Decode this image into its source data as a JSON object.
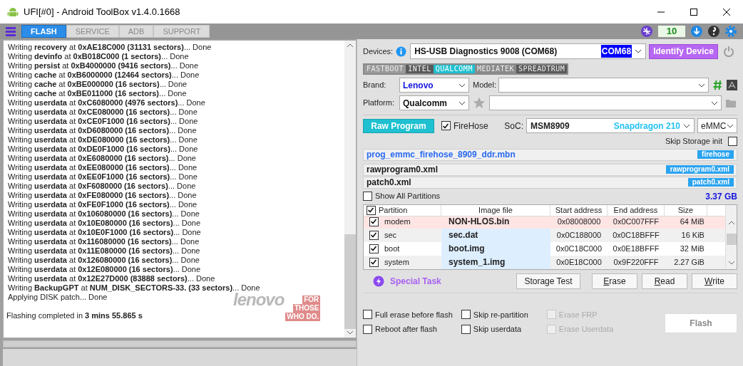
{
  "window": {
    "title": "UFI[#0] - Android ToolBox v1.4.0.1668"
  },
  "toolbar": {
    "tabs": [
      {
        "label": "FLASH",
        "selected": true
      },
      {
        "label": "SERVICE",
        "selected": false
      },
      {
        "label": "ADB",
        "selected": false
      },
      {
        "label": "SUPPORT",
        "selected": false
      }
    ],
    "credits": "10"
  },
  "log": {
    "lines": [
      "Writing **recovery** at **0xAE18C000 (31131 sectors)**... Done",
      "Writing **devinfo** at **0xB018C000 (1 sectors)**... Done",
      "Writing **persist** at **0xB4000000 (9416 sectors)**... Done",
      "Writing **cache** at **0xB6000000 (12464 sectors)**... Done",
      "Writing **cache** at **0xBE000000 (16 sectors)**... Done",
      "Writing **cache** at **0xBE011000 (16 sectors)**... Done",
      "Writing **userdata** at **0xC6080000 (4976 sectors)**... Done",
      "Writing **userdata** at **0xCE080000 (16 sectors)**... Done",
      "Writing **userdata** at **0xCE0F1000 (16 sectors)**... Done",
      "Writing **userdata** at **0xD6080000 (16 sectors)**... Done",
      "Writing **userdata** at **0xDE080000 (16 sectors)**... Done",
      "Writing **userdata** at **0xDE0F1000 (16 sectors)**... Done",
      "Writing **userdata** at **0xE6080000 (16 sectors)**... Done",
      "Writing **userdata** at **0xEE080000 (16 sectors)**... Done",
      "Writing **userdata** at **0xEE0F1000 (16 sectors)**... Done",
      "Writing **userdata** at **0xF6080000 (16 sectors)**... Done",
      "Writing **userdata** at **0xFE080000 (16 sectors)**... Done",
      "Writing **userdata** at **0xFE0F1000 (16 sectors)**... Done",
      "Writing **userdata** at **0x106080000 (16 sectors)**... Done",
      "Writing **userdata** at **0x10E080000 (16 sectors)**... Done",
      "Writing **userdata** at **0x10E0F1000 (16 sectors)**... Done",
      "Writing **userdata** at **0x116080000 (16 sectors)**... Done",
      "Writing **userdata** at **0x11E080000 (16 sectors)**... Done",
      "Writing **userdata** at **0x126080000 (16 sectors)**... Done",
      "Writing **userdata** at **0x12E080000 (16 sectors)**... Done",
      "Writing **userdata** at **0x12E27D000 (83888 sectors)**... Done",
      "Writing **BackupGPT** at **NUM_DISK_SECTORS-33. (33 sectors)**... Done",
      "Applying DISK patch... Done"
    ],
    "summary": "Flashing completed in **3 mins 55.865 s**",
    "brand_logo": {
      "name": "lenovo",
      "tagline": [
        "FOR",
        "THOSE",
        "WHO DO."
      ]
    }
  },
  "devices": {
    "label": "Devices:",
    "value": "HS-USB Diagnostics 9008 (COM68)",
    "port": "COM68",
    "identify": "Identify Device"
  },
  "platform_tabs": [
    {
      "label": "FASTBOOT",
      "selected": false,
      "color": "#9a9a9a"
    },
    {
      "label": "INTEL",
      "selected": false,
      "color": "#5a5a5a"
    },
    {
      "label": "QUALCOMM",
      "selected": true,
      "color": "#1fc1d0"
    },
    {
      "label": "MEDIATEK",
      "selected": false,
      "color": "#8a8a8a"
    },
    {
      "label": "SPREADTRUM",
      "selected": false,
      "color": "#5a5a5a"
    }
  ],
  "brand": {
    "label": "Brand:",
    "value": "Lenovo"
  },
  "model": {
    "label": "Model:"
  },
  "platform": {
    "label": "Platform:",
    "value": "Qualcomm"
  },
  "raw_program": "Raw Program",
  "firehose": {
    "label": "FireHose",
    "checked": true
  },
  "soc": {
    "label": "SoC:",
    "value": "MSM8909",
    "name": "Snapdragon 210"
  },
  "storage": "eMMC",
  "skip_storage_init": {
    "label": "Skip Storage init",
    "checked": false
  },
  "files": [
    {
      "name": "prog_emmc_firehose_8909_ddr.mbn",
      "tag": "firehose",
      "kind": "loader"
    },
    {
      "name": "rawprogram0.xml",
      "tag": "rawprogram0.xml",
      "kind": "xml"
    },
    {
      "name": "patch0.xml",
      "tag": "patch0.xml",
      "kind": "xml"
    }
  ],
  "show_all": {
    "label": "Show All Partitions",
    "checked": false
  },
  "total": "3.37 GB",
  "table": {
    "all_checked": true,
    "columns": [
      "Partition",
      "Image file",
      "Start address",
      "End address",
      "Size"
    ],
    "rows": [
      {
        "partition": "modem",
        "image": "NON-HLOS.bin",
        "start": "0x08008000",
        "end": "0x0C007FFF",
        "size": "64 MiB",
        "checked": true,
        "highlighted": true
      },
      {
        "partition": "sec",
        "image": "sec.dat",
        "start": "0x0C188000",
        "end": "0x0C18BFFF",
        "size": "16 KiB",
        "checked": true,
        "highlighted": false
      },
      {
        "partition": "boot",
        "image": "boot.img",
        "start": "0x0C18C000",
        "end": "0x0E18BFFF",
        "size": "32 MiB",
        "checked": true,
        "highlighted": false
      },
      {
        "partition": "system",
        "image": "system_1.img",
        "start": "0x0E18C000",
        "end": "0x9F220FFF",
        "size": "2.27 GiB",
        "checked": true,
        "highlighted": false
      }
    ]
  },
  "special_task": "Special Task",
  "actions": [
    "Storage Test",
    "Erase",
    "Read",
    "Write"
  ],
  "options": [
    {
      "label": "Full erase before flash",
      "checked": false,
      "disabled": false
    },
    {
      "label": "Reboot after flash",
      "checked": false,
      "disabled": false
    },
    {
      "label": "Skip re-partition",
      "checked": false,
      "disabled": false
    },
    {
      "label": "Skip userdata",
      "checked": false,
      "disabled": false
    },
    {
      "label": "Erase FRP",
      "checked": false,
      "disabled": true
    },
    {
      "label": "Erase Userdata",
      "checked": false,
      "disabled": true
    }
  ],
  "flash_button": {
    "label": "Flash",
    "disabled": true
  }
}
